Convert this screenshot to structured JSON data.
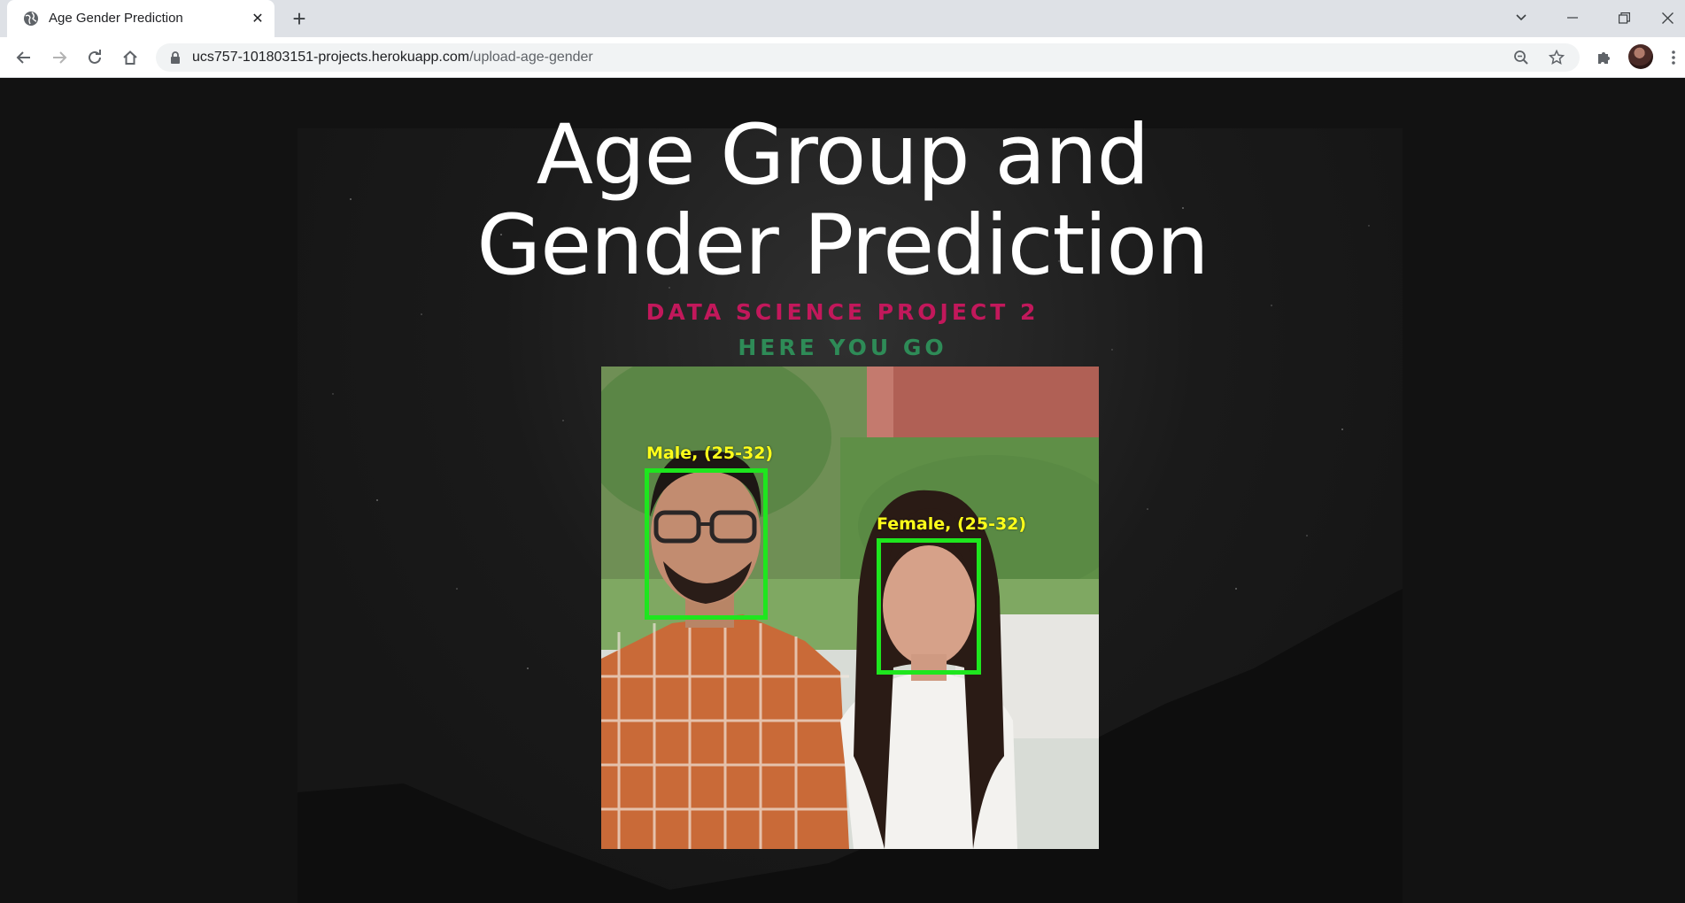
{
  "browser": {
    "tab_title": "Age Gender Prediction",
    "url_host": "ucs757-101803151-projects.herokuapp.com",
    "url_path": "/upload-age-gender"
  },
  "page": {
    "title_line1": "Age Group and",
    "title_line2": "Gender Prediction",
    "subtitle": "DATA SCIENCE PROJECT 2",
    "tagline": "HERE YOU GO",
    "accent_pink": "#c2185b",
    "accent_green": "#2e8b57"
  },
  "result": {
    "detections": [
      {
        "label": "Male, (25-32)"
      },
      {
        "label": "Female, (25-32)"
      }
    ],
    "box_color": "#1ee61e",
    "label_color": "#ffff1a"
  }
}
